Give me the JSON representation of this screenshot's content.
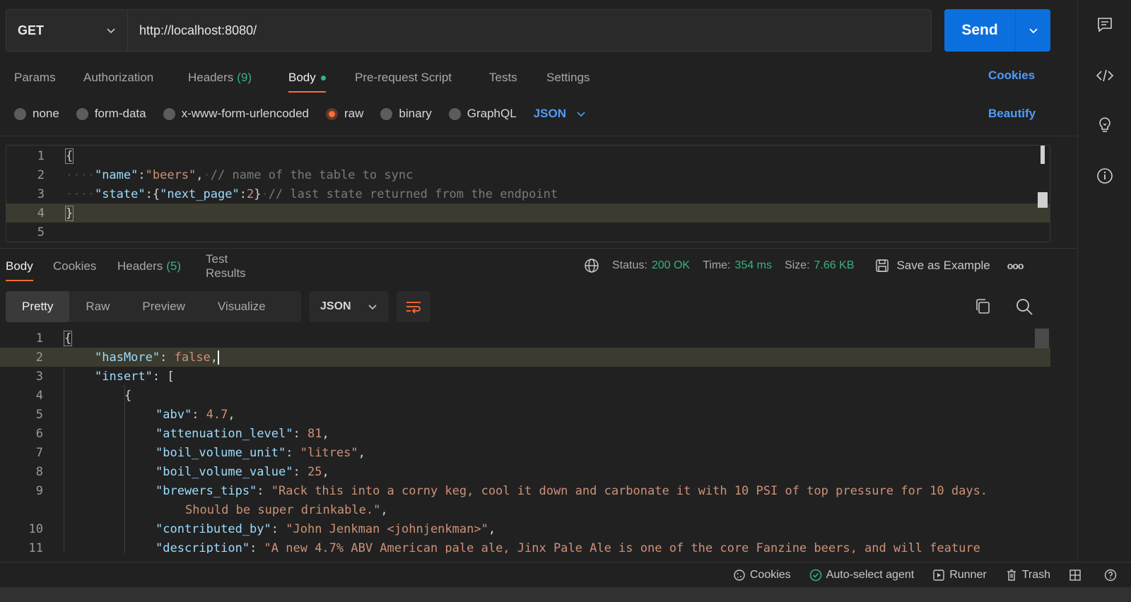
{
  "request": {
    "method": "GET",
    "url": "http://localhost:8080/",
    "send_label": "Send"
  },
  "request_tabs": {
    "params": "Params",
    "authorization": "Authorization",
    "headers": "Headers",
    "headers_count": "(9)",
    "body": "Body",
    "prerequest": "Pre-request Script",
    "tests": "Tests",
    "settings": "Settings",
    "cookies": "Cookies"
  },
  "body_types": {
    "none": "none",
    "form_data": "form-data",
    "urlencoded": "x-www-form-urlencoded",
    "raw": "raw",
    "binary": "binary",
    "graphql": "GraphQL",
    "language": "JSON",
    "beautify": "Beautify"
  },
  "request_editor": {
    "line_numbers": [
      "1",
      "2",
      "3",
      "4",
      "5"
    ],
    "line1": "{",
    "line2_key": "\"name\"",
    "line2_colon": ":",
    "line2_value": "\"beers\"",
    "line2_comma": ",",
    "line2_comment": "// name of the table to sync",
    "line3_key": "\"state\"",
    "line3_open": ":{",
    "line3_inner_key": "\"next_page\"",
    "line3_inner_colon": ":",
    "line3_inner_value": "2",
    "line3_close": "}",
    "line3_comment": "// last state returned from the endpoint",
    "line4": "}"
  },
  "response_tabs": {
    "body": "Body",
    "cookies": "Cookies",
    "headers": "Headers",
    "headers_count": "(5)",
    "test_results": "Test Results"
  },
  "response_meta": {
    "status_label": "Status:",
    "status_value": "200 OK",
    "time_label": "Time:",
    "time_value": "354 ms",
    "size_label": "Size:",
    "size_value": "7.66 KB",
    "save_example": "Save as Example",
    "more": "ooo"
  },
  "view_modes": {
    "pretty": "Pretty",
    "raw": "Raw",
    "preview": "Preview",
    "visualize": "Visualize",
    "format": "JSON"
  },
  "response_body": {
    "line_numbers": [
      "1",
      "2",
      "3",
      "4",
      "5",
      "6",
      "7",
      "8",
      "9",
      "10",
      "11"
    ],
    "l1": "{",
    "l2_key": "\"hasMore\"",
    "l2_value": "false",
    "l3_key": "\"insert\"",
    "l3_value": "[",
    "l4": "{",
    "l5_key": "\"abv\"",
    "l5_value": "4.7",
    "l6_key": "\"attenuation_level\"",
    "l6_value": "81",
    "l7_key": "\"boil_volume_unit\"",
    "l7_value": "\"litres\"",
    "l8_key": "\"boil_volume_value\"",
    "l8_value": "25",
    "l9_key": "\"brewers_tips\"",
    "l9_value": "\"Rack this into a corny keg, cool it down and carbonate it with 10 PSI of top pressure for 10 days.",
    "l9_wrap": "Should be super drinkable.\"",
    "l10_key": "\"contributed_by\"",
    "l10_value": "\"John Jenkman <johnjenkman>\"",
    "l11_key": "\"description\"",
    "l11_value": "\"A new 4.7% ABV American pale ale, Jinx Pale Ale is one of the core Fanzine beers, and will feature"
  },
  "status_bar": {
    "cookies": "Cookies",
    "agent": "Auto-select agent",
    "runner": "Runner",
    "trash": "Trash"
  }
}
